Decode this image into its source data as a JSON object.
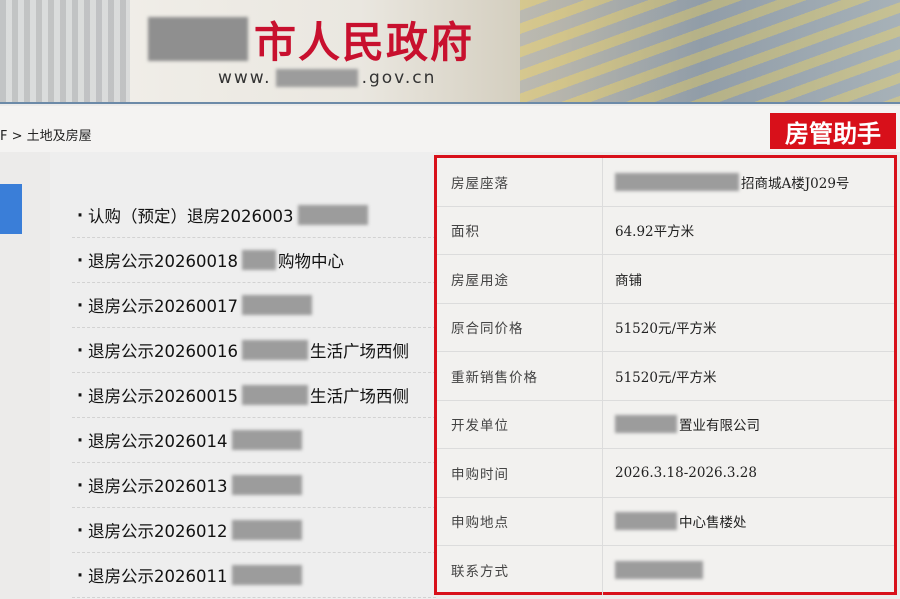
{
  "header": {
    "title": "市人民政府",
    "url_prefix": "www.",
    "url_suffix": ".gov.cn"
  },
  "breadcrumb": "F > 土地及房屋",
  "badge": "房管助手",
  "list": [
    {
      "text": "认购（预定）退房2026003",
      "suffix": ""
    },
    {
      "text": "退房公示20260018",
      "suffix": "购物中心"
    },
    {
      "text": "退房公示20260017",
      "suffix": ""
    },
    {
      "text": "退房公示20260016",
      "suffix": "生活广场西侧"
    },
    {
      "text": "退房公示20260015",
      "suffix": "生活广场西侧"
    },
    {
      "text": "退房公示2026014",
      "suffix": ""
    },
    {
      "text": "退房公示2026013",
      "suffix": ""
    },
    {
      "text": "退房公示2026012",
      "suffix": ""
    },
    {
      "text": "退房公示2026011",
      "suffix": ""
    }
  ],
  "info": [
    {
      "label": "房屋座落",
      "value": "招商城A楼J029号"
    },
    {
      "label": "面积",
      "value": "64.92平方米"
    },
    {
      "label": "房屋用途",
      "value": "商铺"
    },
    {
      "label": "原合同价格",
      "value": "51520元/平方米"
    },
    {
      "label": "重新销售价格",
      "value": "51520元/平方米"
    },
    {
      "label": "开发单位",
      "value": "置业有限公司"
    },
    {
      "label": "申购时间",
      "value": "2026.3.18-2026.3.28"
    },
    {
      "label": "申购地点",
      "value": "中心售楼处"
    },
    {
      "label": "联系方式",
      "value": ""
    }
  ],
  "colors": {
    "accent_red": "#d8101a",
    "title_red": "#c8102e",
    "tab_blue": "#3a7ed8"
  }
}
